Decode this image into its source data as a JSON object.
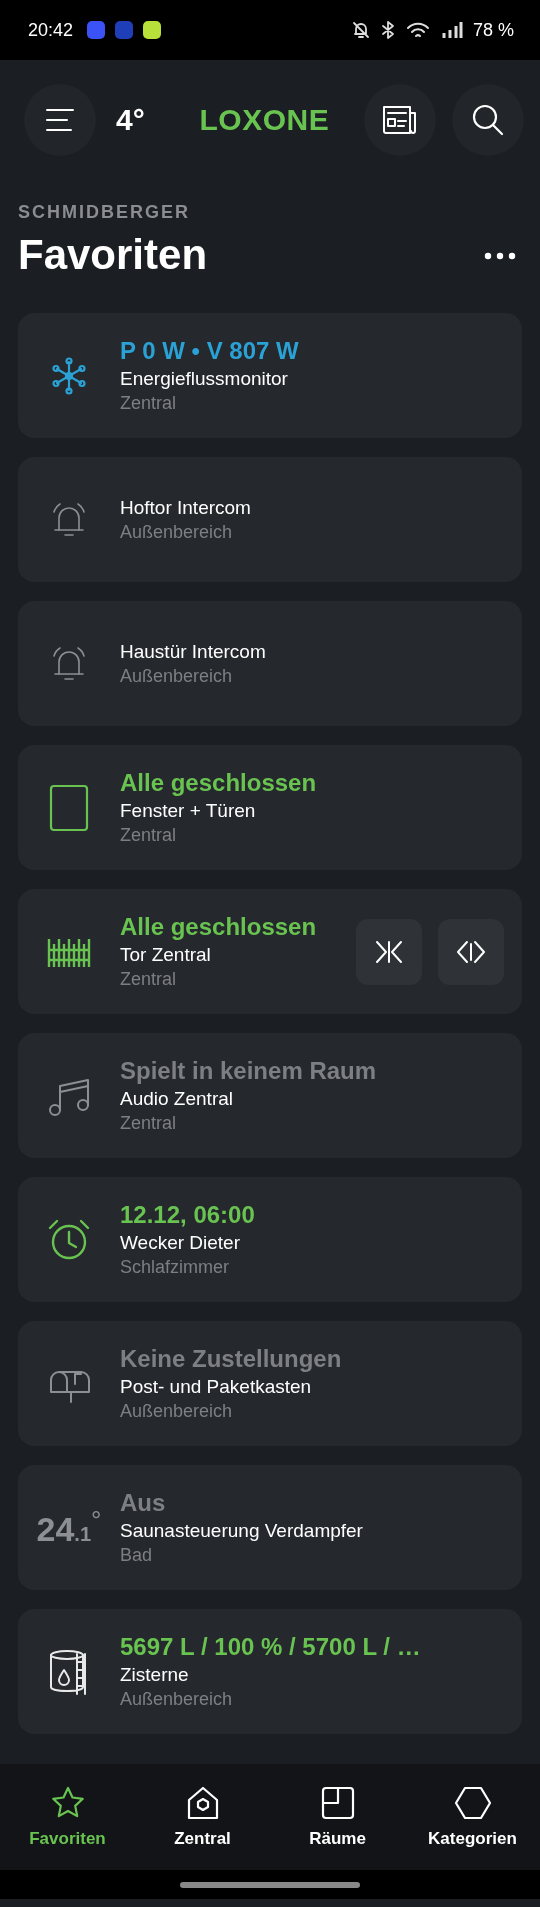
{
  "status_bar": {
    "time": "20:42",
    "battery": "78 %"
  },
  "header": {
    "temperature": "4°",
    "logo": "LOXONE"
  },
  "section": {
    "subtitle": "SCHMIDBERGER",
    "title": "Favoriten"
  },
  "cards": [
    {
      "kind": "flow",
      "status": "P 0 W • V 807 W",
      "color": "#2aa2d6",
      "name": "Energieflussmonitor",
      "room": "Zentral"
    },
    {
      "kind": "bell",
      "name": "Hoftor Intercom",
      "room": "Außenbereich"
    },
    {
      "kind": "bell",
      "name": "Haustür Intercom",
      "room": "Außenbereich"
    },
    {
      "kind": "window",
      "status": "Alle geschlossen",
      "color": "#69c350",
      "name": "Fenster + Türen",
      "room": "Zentral"
    },
    {
      "kind": "gate",
      "status": "Alle geschlossen",
      "color": "#69c350",
      "name": "Tor Zentral",
      "room": "Zentral",
      "actions": [
        {
          "kind": "close"
        },
        {
          "kind": "open"
        }
      ]
    },
    {
      "kind": "music",
      "status": "Spielt in keinem Raum",
      "color": "#7d7f83",
      "name": "Audio Zentral",
      "room": "Zentral"
    },
    {
      "kind": "alarm",
      "status": "12.12, 06:00",
      "color": "#69c350",
      "name": "Wecker Dieter",
      "room": "Schlafzimmer"
    },
    {
      "kind": "mailbox",
      "status": "Keine Zustellungen",
      "color": "#7d7f83",
      "name": "Post- und Paketkasten",
      "room": "Außenbereich"
    },
    {
      "kind": "temperature",
      "temp_whole": "24",
      "temp_fraction": ".1",
      "temp_unit": "°",
      "status": "Aus",
      "color": "#7d7f83",
      "name": "Saunasteuerung Verdampfer",
      "room": "Bad"
    },
    {
      "kind": "tank",
      "status": "5697 L / 100 % / 5700 L / …",
      "color": "#69c350",
      "name": "Zisterne",
      "room": "Außenbereich"
    }
  ],
  "nav": [
    {
      "kind": "star",
      "label": "Favoriten",
      "selected": true
    },
    {
      "kind": "house",
      "label": "Zentral",
      "selected": false
    },
    {
      "kind": "rooms",
      "label": "Räume",
      "selected": false
    },
    {
      "kind": "hexagon",
      "label": "Kategorien",
      "selected": false
    }
  ]
}
